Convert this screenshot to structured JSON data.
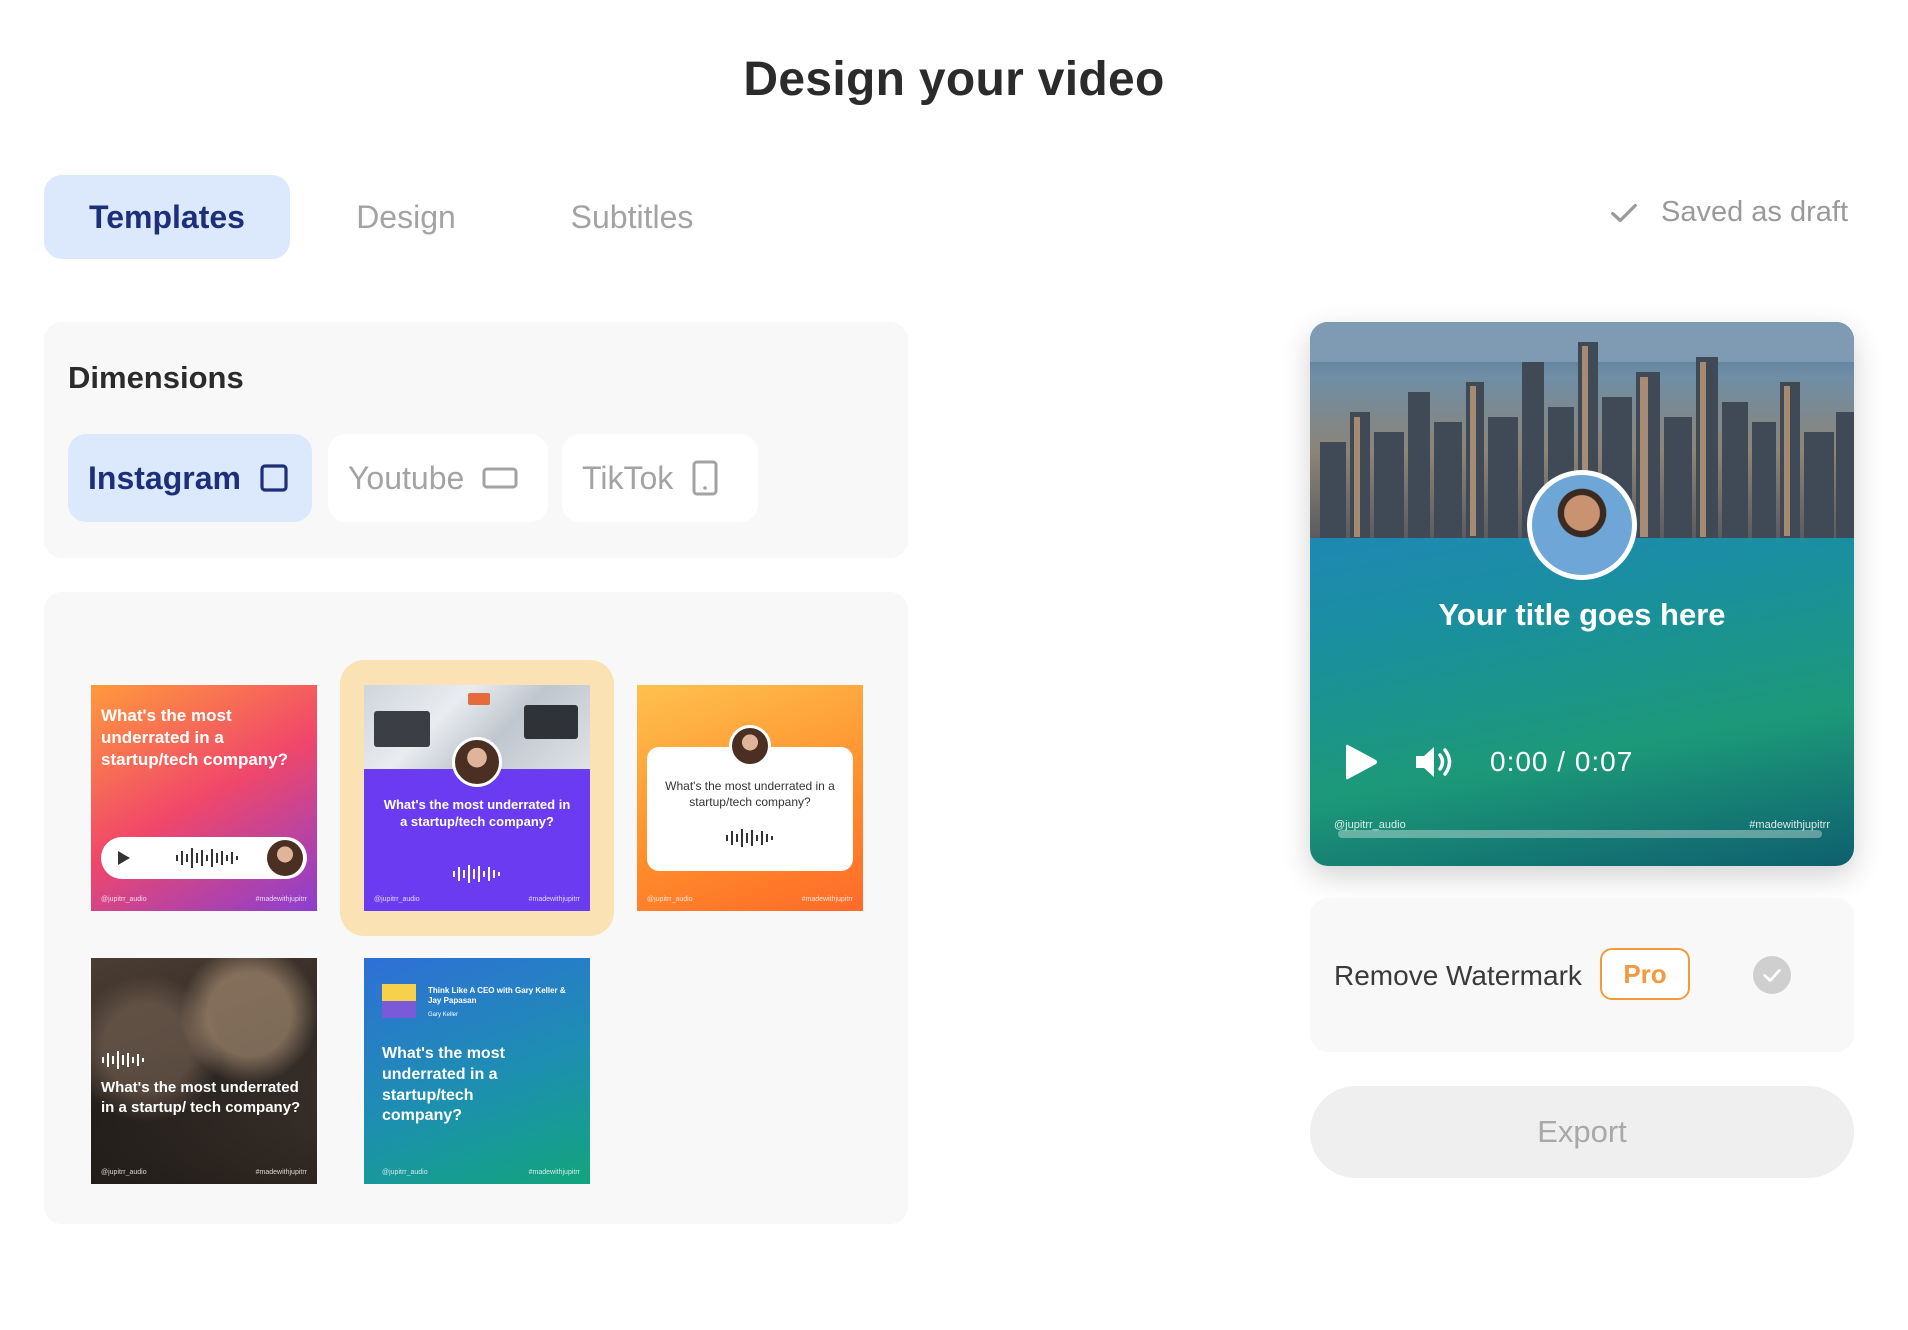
{
  "page": {
    "title": "Design your video"
  },
  "tabs": [
    {
      "label": "Templates",
      "active": true
    },
    {
      "label": "Design",
      "active": false
    },
    {
      "label": "Subtitles",
      "active": false
    }
  ],
  "status": {
    "saved_text": "Saved as draft",
    "icon": "check-icon"
  },
  "dimensions": {
    "title": "Dimensions",
    "options": [
      {
        "label": "Instagram",
        "icon": "square-icon",
        "active": true
      },
      {
        "label": "Youtube",
        "icon": "landscape-icon",
        "active": false
      },
      {
        "label": "TikTok",
        "icon": "portrait-icon",
        "active": false
      }
    ]
  },
  "templates": [
    {
      "text": "What's the most underrated in a startup/tech company?",
      "handle": "@jupitrr_audio",
      "tag": "#madewithjupitrr"
    },
    {
      "text": "What's the most underrated in a startup/tech company?",
      "handle": "@jupitrr_audio",
      "tag": "#madewithjupitrr",
      "selected": true
    },
    {
      "text": "What's the most underrated in a startup/tech company?",
      "handle": "@jupitrr_audio",
      "tag": "#madewithjupitrr"
    },
    {
      "text": "What's the most underrated in a startup/ tech company?",
      "handle": "@jupitrr_audio",
      "tag": "#madewithjupitrr"
    },
    {
      "podcast": "Think Like A CEO with Gary Keller & Jay Papasan",
      "host": "Gary Keller",
      "text": "What's the most underrated in a startup/tech company?",
      "handle": "@jupitrr_audio",
      "tag": "#madewithjupitrr"
    }
  ],
  "preview": {
    "title": "Your title goes here",
    "time": "0:00 / 0:07",
    "handle": "@jupitrr_audio",
    "tag": "#madewithjupitrr",
    "progress": 0
  },
  "watermark": {
    "label": "Remove Watermark",
    "badge": "Pro",
    "checked": false
  },
  "export": {
    "label": "Export"
  },
  "colors": {
    "accent_bg": "#dce8fb",
    "accent_text": "#1e2f7a",
    "pro": "#f39a3d"
  }
}
